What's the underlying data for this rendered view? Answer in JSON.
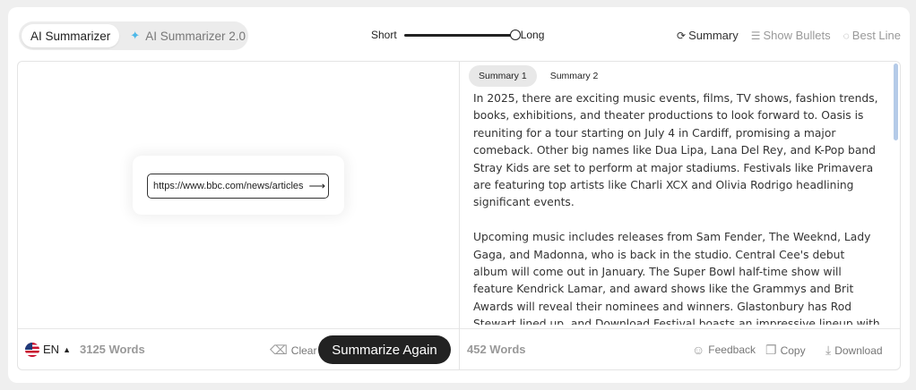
{
  "modes": {
    "ai_summarizer": "AI Summarizer",
    "ai_summarizer_2": "AI Summarizer 2.0"
  },
  "length": {
    "min_label": "Short",
    "max_label": "Long",
    "value": 1.0
  },
  "view_options": {
    "summary": "Summary",
    "show_bullets": "Show Bullets",
    "best_line": "Best Line"
  },
  "input": {
    "url": "https://www.bbc.com/news/articles",
    "language": "EN",
    "word_count": "3125 Words",
    "clear_label": "Clear",
    "summarize_label": "Summarize Again"
  },
  "output": {
    "tabs": [
      "Summary 1",
      "Summary 2"
    ],
    "paragraphs": [
      "In 2025, there are exciting music events, films, TV shows, fashion trends, books, exhibitions, and theater productions to look forward to. Oasis is reuniting for a tour starting on July 4 in Cardiff, promising a major comeback. Other big names like Dua Lipa, Lana Del Rey, and K-Pop band Stray Kids are set to perform at major stadiums. Festivals like Primavera are featuring top artists like Charli XCX and Olivia Rodrigo headlining significant events.",
      "Upcoming music includes releases from Sam Fender, The Weeknd, Lady Gaga, and Madonna, who is back in the studio. Central Cee's debut album will come out in January. The Super Bowl half-time show will feature Kendrick Lamar, and award shows like the Grammys and Brit Awards will reveal their nominees and winners. Glastonbury has Rod Stewart lined up, and Download Festival boasts an impressive lineup with bands like Green Day and Sex Pistols."
    ],
    "word_count": "452 Words",
    "feedback_label": "Feedback",
    "copy_label": "Copy",
    "download_label": "Download"
  }
}
